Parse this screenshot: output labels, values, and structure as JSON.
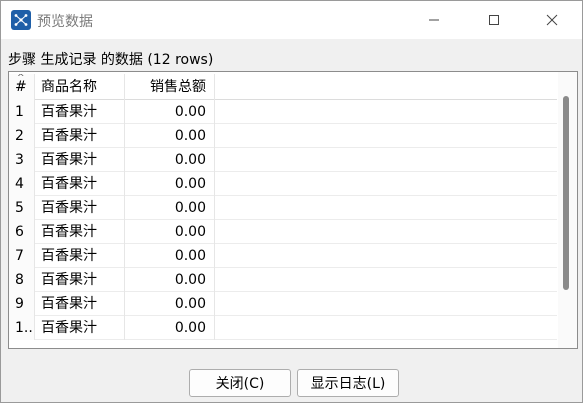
{
  "window": {
    "title": "预览数据",
    "icons": {
      "app": "app-network-icon",
      "minimize": "minimize-icon",
      "maximize": "maximize-icon",
      "close": "close-icon"
    }
  },
  "step_label": "步骤 生成记录 的数据  (12 rows)",
  "table": {
    "columns": [
      "#",
      "商品名称",
      "销售总额"
    ],
    "rows": [
      {
        "idx": "1",
        "name": "百香果汁",
        "sales": "0.00"
      },
      {
        "idx": "2",
        "name": "百香果汁",
        "sales": "0.00"
      },
      {
        "idx": "3",
        "name": "百香果汁",
        "sales": "0.00"
      },
      {
        "idx": "4",
        "name": "百香果汁",
        "sales": "0.00"
      },
      {
        "idx": "5",
        "name": "百香果汁",
        "sales": "0.00"
      },
      {
        "idx": "6",
        "name": "百香果汁",
        "sales": "0.00"
      },
      {
        "idx": "7",
        "name": "百香果汁",
        "sales": "0.00"
      },
      {
        "idx": "8",
        "name": "百香果汁",
        "sales": "0.00"
      },
      {
        "idx": "9",
        "name": "百香果汁",
        "sales": "0.00"
      },
      {
        "idx": "1..",
        "name": "百香果汁",
        "sales": "0.00"
      }
    ]
  },
  "buttons": {
    "close": "关闭(C)",
    "log": "显示日志(L)"
  }
}
